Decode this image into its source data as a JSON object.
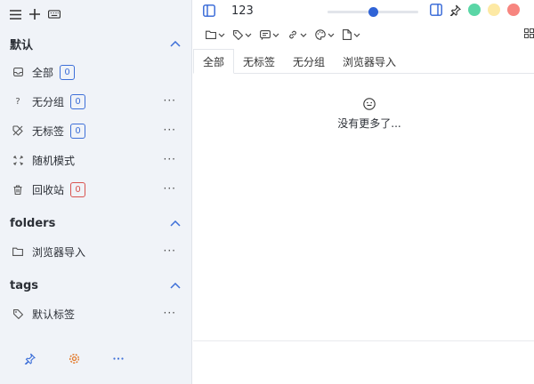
{
  "colors": {
    "accent": "#3d6fd8",
    "danger": "#d9534f",
    "dot_green": "#5ad6a6",
    "dot_yellow": "#fde9a4",
    "dot_red": "#f7857f"
  },
  "sidebar": {
    "top_icons": [
      "menu-icon",
      "plus-icon",
      "keyboard-icon"
    ],
    "sections": [
      {
        "title": "默认",
        "items": [
          {
            "icon": "inbox-icon",
            "label": "全部",
            "count": "0",
            "badge_color": "accent",
            "has_more": false
          },
          {
            "icon": "question-icon",
            "label": "无分组",
            "count": "0",
            "badge_color": "accent",
            "has_more": true
          },
          {
            "icon": "tag-off-icon",
            "label": "无标签",
            "count": "0",
            "badge_color": "accent",
            "has_more": true
          },
          {
            "icon": "shuffle-icon",
            "label": "随机模式",
            "count": "",
            "has_more": true
          },
          {
            "icon": "trash-icon",
            "label": "回收站",
            "count": "0",
            "badge_color": "danger",
            "has_more": true
          }
        ]
      },
      {
        "title": "folders",
        "items": [
          {
            "icon": "folder-icon",
            "label": "浏览器导入",
            "has_more": true
          }
        ]
      },
      {
        "title": "tags",
        "items": [
          {
            "icon": "tag-icon",
            "label": "默认标签",
            "has_more": true
          }
        ]
      }
    ],
    "more_label": "···",
    "bottom_icons": [
      "pin-icon",
      "settings-icon",
      "more-icon"
    ]
  },
  "main": {
    "title": "123",
    "zoom_slider_value": 0.5,
    "toolbar2": [
      "folder-icon",
      "tag-icon",
      "note-icon",
      "link-icon",
      "palette-icon",
      "file-icon"
    ],
    "tabs": [
      "全部",
      "无标签",
      "无分组",
      "浏览器导入"
    ],
    "active_tab": 0,
    "empty_icon": "smile-icon",
    "empty_message": "没有更多了..."
  }
}
